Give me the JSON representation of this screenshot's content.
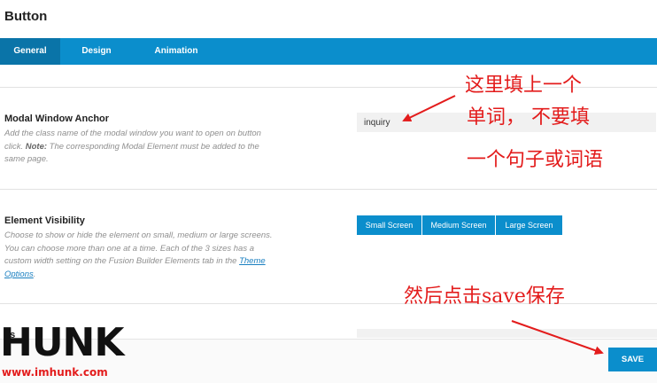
{
  "header": {
    "title": "Button"
  },
  "tabs": [
    {
      "label": "General",
      "active": true
    },
    {
      "label": "Design",
      "active": false
    },
    {
      "label": "Animation",
      "active": false
    }
  ],
  "modal_anchor": {
    "title": "Modal Window Anchor",
    "desc_part1": "Add the class name of the modal window you want to open on button click. ",
    "desc_note": "Note:",
    "desc_part2": " The corresponding Modal Element must be added to the same page.",
    "value": "inquiry"
  },
  "visibility": {
    "title": "Element Visibility",
    "desc_part1": "Choose to show or hide the element on small, medium or large screens. You can choose more than one at a time. Each of the 3 sizes has a custom width setting on the Fusion Builder Elements tab in the ",
    "desc_link": "Theme Options",
    "desc_part2": ".",
    "buttons": [
      "Small Screen",
      "Medium Screen",
      "Large Screen"
    ]
  },
  "next_option": {
    "partial_title": "ss"
  },
  "footer": {
    "save_label": "SAVE"
  },
  "annotations": {
    "top_line1": "这里填上一个",
    "top_line2": "单词， 不要填",
    "top_line3": "一个句子或词语",
    "bottom": "然后点击save保存"
  },
  "watermark": {
    "logo": "HUNK",
    "url": "www.imhunk.com"
  },
  "colors": {
    "accent": "#0b8ecc",
    "active_tab": "#0a74a8",
    "annotation": "#e31c1c"
  }
}
